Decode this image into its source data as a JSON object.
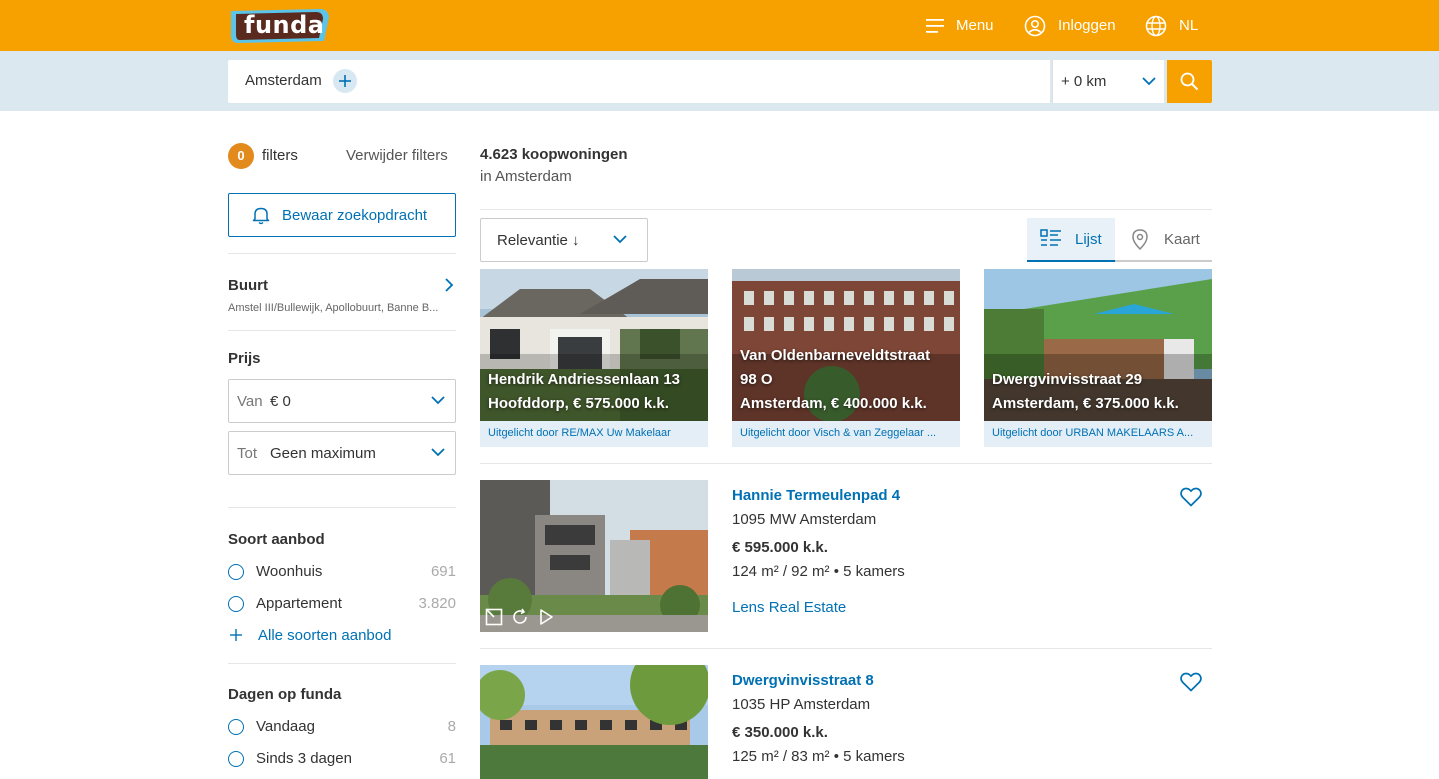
{
  "header": {
    "logo": "funda",
    "menu": "Menu",
    "login": "Inloggen",
    "language": "NL"
  },
  "search": {
    "location": "Amsterdam",
    "radius": "+ 0 km"
  },
  "sidebar": {
    "filter_count": "0",
    "filters_label": "filters",
    "clear_filters": "Verwijder filters",
    "save_search": "Bewaar zoekopdracht",
    "neighbourhood": {
      "title": "Buurt",
      "summary": "Amstel III/Bullewijk, Apollobuurt, Banne B..."
    },
    "price": {
      "title": "Prijs",
      "from_label": "Van",
      "from_value": "€ 0",
      "to_label": "Tot",
      "to_value": "Geen maximum"
    },
    "offer_type": {
      "title": "Soort aanbod",
      "options": [
        {
          "label": "Woonhuis",
          "count": "691"
        },
        {
          "label": "Appartement",
          "count": "3.820"
        }
      ],
      "more": "Alle soorten aanbod"
    },
    "days": {
      "title": "Dagen op funda",
      "options": [
        {
          "label": "Vandaag",
          "count": "8"
        },
        {
          "label": "Sinds 3 dagen",
          "count": "61"
        }
      ]
    }
  },
  "results": {
    "count": "4.623 koopwoningen",
    "location": "in Amsterdam",
    "sort": "Relevantie ↓",
    "view_list": "Lijst",
    "view_map": "Kaart"
  },
  "featured": [
    {
      "line1": "Hendrik Andriessenlaan 13",
      "line2": "Hoofddorp, € 575.000 k.k.",
      "promo": "Uitgelicht door RE/MAX Uw Makelaar"
    },
    {
      "line1": "Van Oldenbarneveldtstraat",
      "line1b": "98 O",
      "line2": "Amsterdam, € 400.000 k.k.",
      "promo": "Uitgelicht door Visch & van Zeggelaar ..."
    },
    {
      "line1": "Dwergvinvisstraat 29",
      "line2": "Amsterdam, € 375.000 k.k.",
      "promo": "Uitgelicht door URBAN MAKELAARS A..."
    }
  ],
  "listings": [
    {
      "title": "Hannie Termeulenpad 4",
      "address": "1095 MW Amsterdam",
      "price": "€ 595.000 k.k.",
      "specs": "124 m² / 92 m²  •  5 kamers",
      "agent": "Lens Real Estate"
    },
    {
      "title": "Dwergvinvisstraat 8",
      "address": "1035 HP Amsterdam",
      "price": "€ 350.000 k.k.",
      "specs": "125 m² / 83 m²  •  5 kamers"
    }
  ],
  "colors": {
    "brand_orange": "#f7a100",
    "link_blue": "#0071b3",
    "search_band": "#dbe8f0"
  }
}
